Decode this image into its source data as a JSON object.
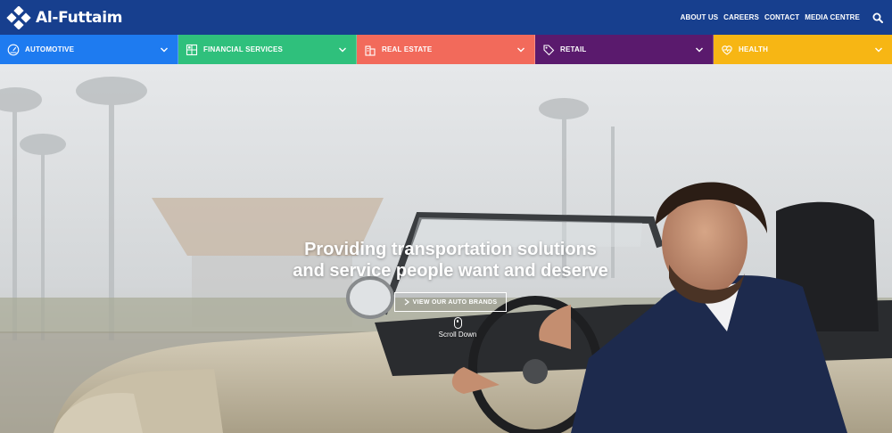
{
  "header": {
    "logo_text": "Al-Futtaim",
    "nav": [
      "ABOUT US",
      "CAREERS",
      "CONTACT",
      "MEDIA CENTRE"
    ],
    "search_icon": "search-icon",
    "background": "#173f8e"
  },
  "divisions": [
    {
      "label": "AUTOMOTIVE",
      "icon": "speedometer-icon",
      "color": "#1e7bf0"
    },
    {
      "label": "FINANCIAL SERVICES",
      "icon": "calculator-icon",
      "color": "#2fc07c"
    },
    {
      "label": "REAL ESTATE",
      "icon": "buildings-icon",
      "color": "#f26a5b"
    },
    {
      "label": "RETAIL",
      "icon": "tag-icon",
      "color": "#5a1a6d"
    },
    {
      "label": "HEALTH",
      "icon": "heart-pulse-icon",
      "color": "#f7b614"
    }
  ],
  "hero": {
    "title": "Providing transportation solutions\nand service people want and deserve",
    "cta_label": "VIEW OUR AUTO BRANDS",
    "scroll_label": "Scroll Down"
  }
}
